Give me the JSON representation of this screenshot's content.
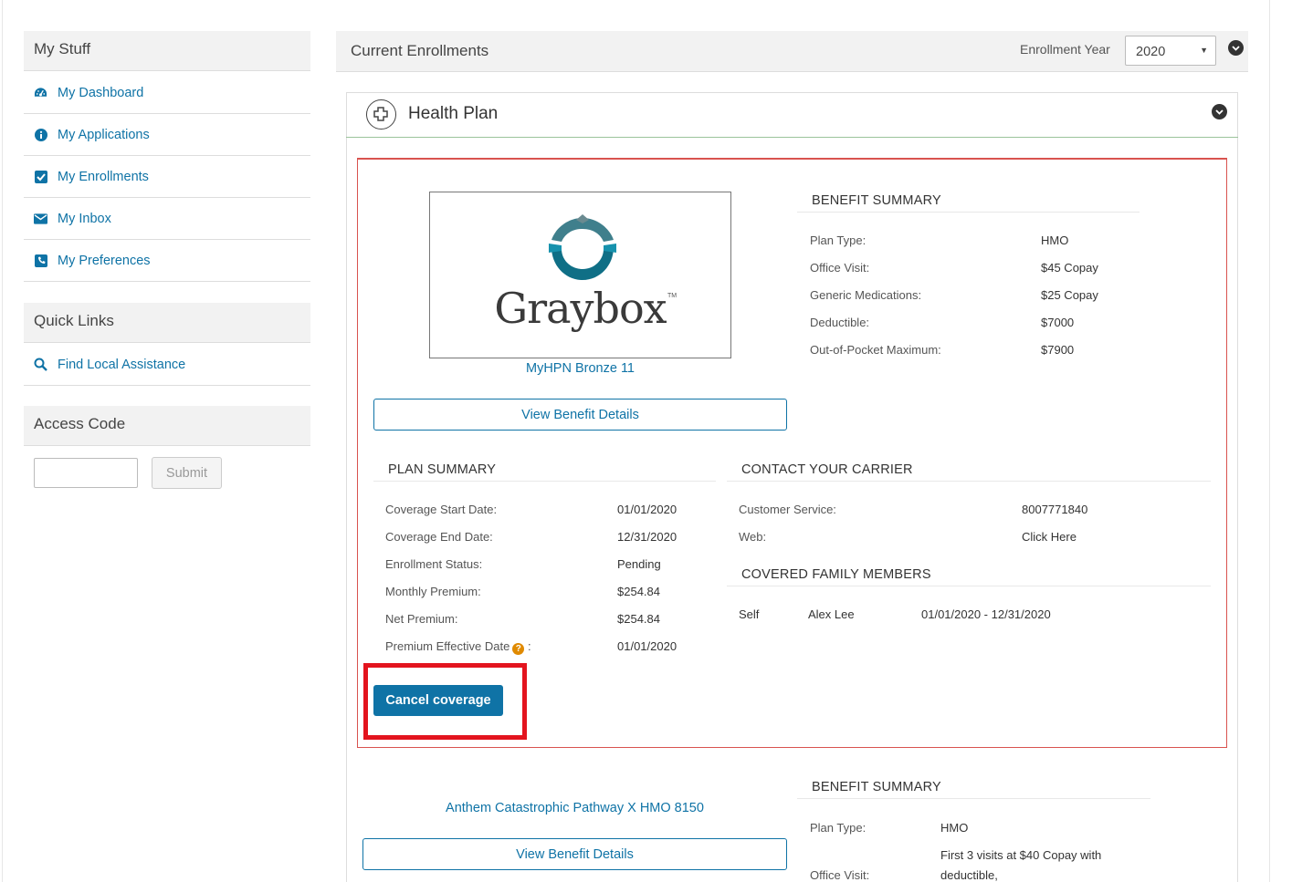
{
  "sidebar": {
    "my_stuff": {
      "title": "My Stuff",
      "items": [
        {
          "label": "My Dashboard",
          "icon": "dashboard-icon"
        },
        {
          "label": "My Applications",
          "icon": "info-icon"
        },
        {
          "label": "My Enrollments",
          "icon": "checkbox-icon"
        },
        {
          "label": "My Inbox",
          "icon": "envelope-icon"
        },
        {
          "label": "My Preferences",
          "icon": "phone-icon"
        }
      ]
    },
    "quick_links": {
      "title": "Quick Links",
      "items": [
        {
          "label": "Find Local Assistance",
          "icon": "search-icon"
        }
      ]
    },
    "access_code": {
      "title": "Access Code",
      "input_value": "",
      "submit_label": "Submit"
    }
  },
  "main": {
    "title": "Current Enrollments",
    "enrollment_year_label": "Enrollment Year",
    "enrollment_year_value": "2020",
    "health_plan": {
      "title": "Health Plan",
      "plan1": {
        "logo_text": "Graybox",
        "logo_tm": "TM",
        "plan_name": "MyHPN Bronze 11",
        "view_details_label": "View Benefit Details",
        "benefit_summary": {
          "title": "BENEFIT SUMMARY",
          "rows": [
            {
              "label": "Plan Type:",
              "value": "HMO"
            },
            {
              "label": "Office Visit:",
              "value": "$45 Copay"
            },
            {
              "label": "Generic Medications:",
              "value": "$25 Copay"
            },
            {
              "label": "Deductible:",
              "value": "$7000"
            },
            {
              "label": "Out-of-Pocket Maximum:",
              "value": "$7900"
            }
          ]
        },
        "plan_summary": {
          "title": "PLAN SUMMARY",
          "rows": [
            {
              "label": "Coverage Start Date:",
              "value": "01/01/2020"
            },
            {
              "label": "Coverage End Date:",
              "value": "12/31/2020"
            },
            {
              "label": "Enrollment Status:",
              "value": "Pending"
            },
            {
              "label": "Monthly Premium:",
              "value": "$254.84"
            },
            {
              "label": "Net Premium:",
              "value": "$254.84"
            },
            {
              "label": "Premium Effective Date",
              "value": "01/01/2020"
            }
          ],
          "help_glyph": "?",
          "colon": ":"
        },
        "contact": {
          "title": "CONTACT YOUR CARRIER",
          "customer_service_label": "Customer Service:",
          "customer_service_value": "8007771840",
          "web_label": "Web:",
          "web_value": "Click Here"
        },
        "family": {
          "title": "COVERED FAMILY MEMBERS",
          "members": [
            {
              "relation": "Self",
              "name": "Alex Lee",
              "dates": "01/01/2020 - 12/31/2020"
            }
          ]
        },
        "cancel_label": "Cancel coverage"
      },
      "plan2": {
        "plan_name": "Anthem Catastrophic Pathway X HMO 8150",
        "view_details_label": "View Benefit Details",
        "benefit_summary": {
          "title": "BENEFIT SUMMARY",
          "plan_type_label": "Plan Type:",
          "plan_type_value": "HMO",
          "office_visit_label": "Office Visit:",
          "office_visit_value_line1": "First 3 visits at $40 Copay with",
          "office_visit_value_line2": "deductible,"
        }
      }
    }
  },
  "colors": {
    "accent": "#0f73a6",
    "highlight": "#e3141e",
    "panel_border": "#d9534f",
    "help": "#e08a00"
  }
}
